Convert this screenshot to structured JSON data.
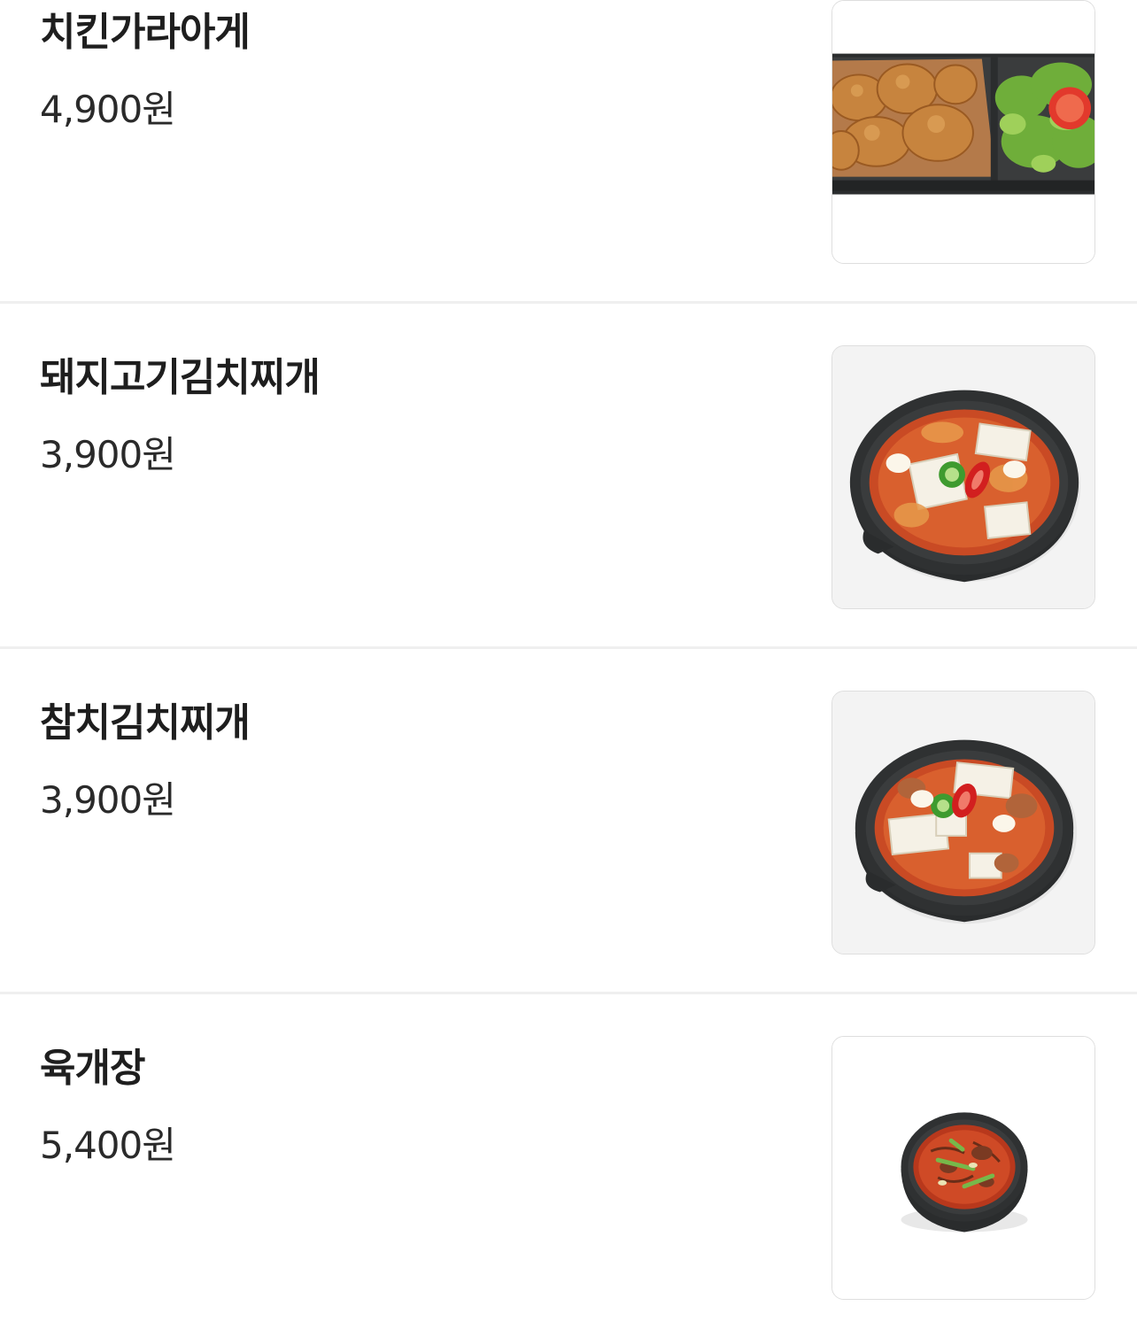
{
  "menu": {
    "items": [
      {
        "name": "치킨가라아게",
        "price": "4,900원",
        "image_icon": "fried-chicken-box-icon"
      },
      {
        "name": "돼지고기김치찌개",
        "price": "3,900원",
        "image_icon": "kimchi-stew-bowl-icon"
      },
      {
        "name": "참치김치찌개",
        "price": "3,900원",
        "image_icon": "kimchi-stew-bowl-icon"
      },
      {
        "name": "육개장",
        "price": "5,400원",
        "image_icon": "spicy-beef-soup-bowl-icon"
      }
    ]
  },
  "colors": {
    "background": "#ffffff",
    "divider": "#efefef",
    "text_primary": "#1e1e1e",
    "image_border": "#dedede"
  }
}
